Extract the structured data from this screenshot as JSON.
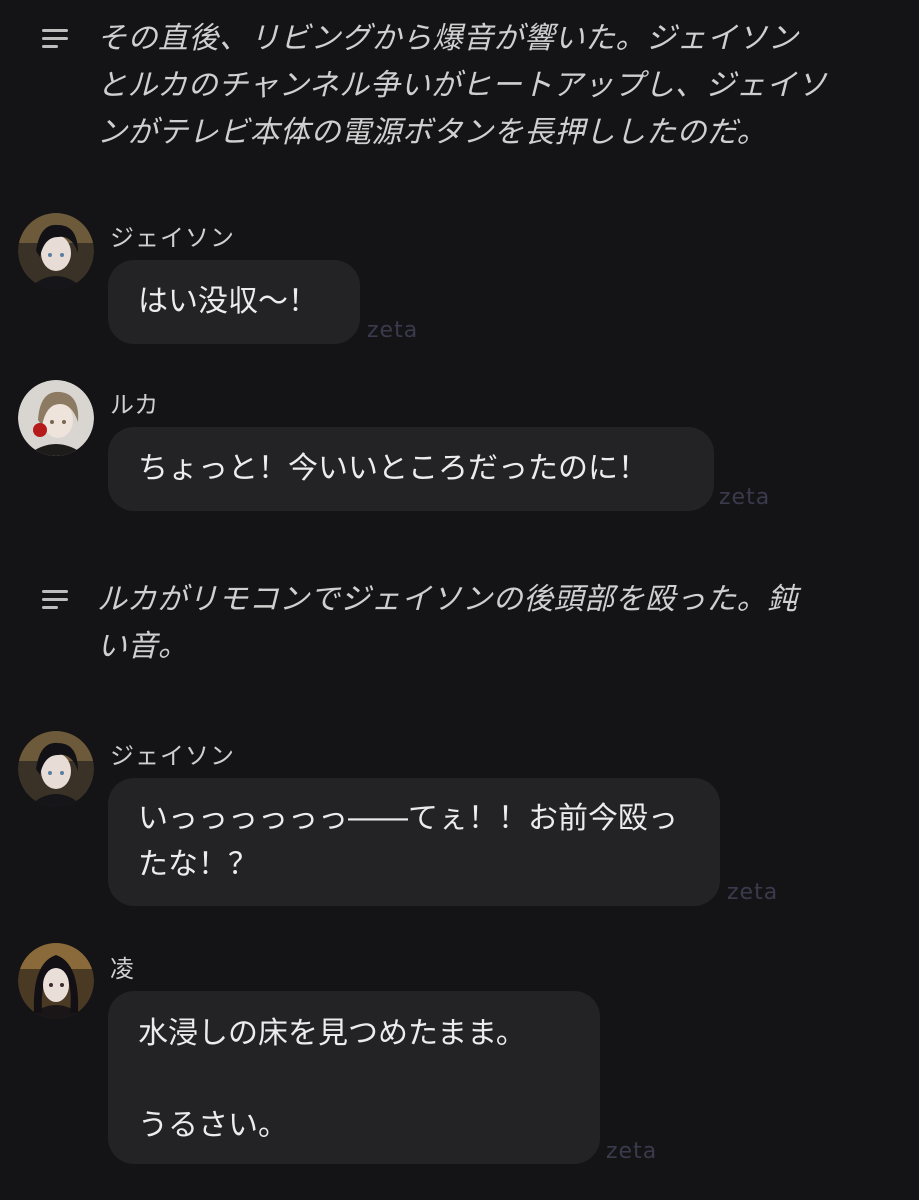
{
  "narration_1": {
    "lines": [
      "その直後、リビングから爆音が響いた。ジェイソン",
      "とルカのチャンネル争いがヒートアップし、ジェイソ",
      "ンがテレビ本体の電源ボタンを長押ししたのだ。"
    ]
  },
  "message_1": {
    "speaker": "ジェイソン",
    "lines": [
      "はい没収〜！"
    ],
    "watermark": "zeta"
  },
  "message_2": {
    "speaker": "ルカ",
    "lines": [
      "ちょっと！今いいところだったのに！"
    ],
    "watermark": "zeta"
  },
  "narration_2": {
    "lines": [
      "ルカがリモコンでジェイソンの後頭部を殴った。鈍",
      "い音。"
    ]
  },
  "message_3": {
    "speaker": "ジェイソン",
    "lines": [
      "いっっっっっっ――てぇ！！お前今殴っ",
      "たな！？"
    ],
    "watermark": "zeta"
  },
  "message_4": {
    "speaker": "凌",
    "lines": [
      "水浸しの床を見つめたまま。",
      "",
      "うるさい。"
    ],
    "watermark": "zeta"
  },
  "colors": {
    "background": "#141416",
    "bubble": "#232325",
    "watermark": "#3b3a4c",
    "narration_text": "#cfcfcf"
  },
  "icons": {
    "narration": "text-lines-icon",
    "avatar_jason": "avatar-dark-hair",
    "avatar_luca": "avatar-light-hair",
    "avatar_ryo": "avatar-long-dark-hair"
  }
}
